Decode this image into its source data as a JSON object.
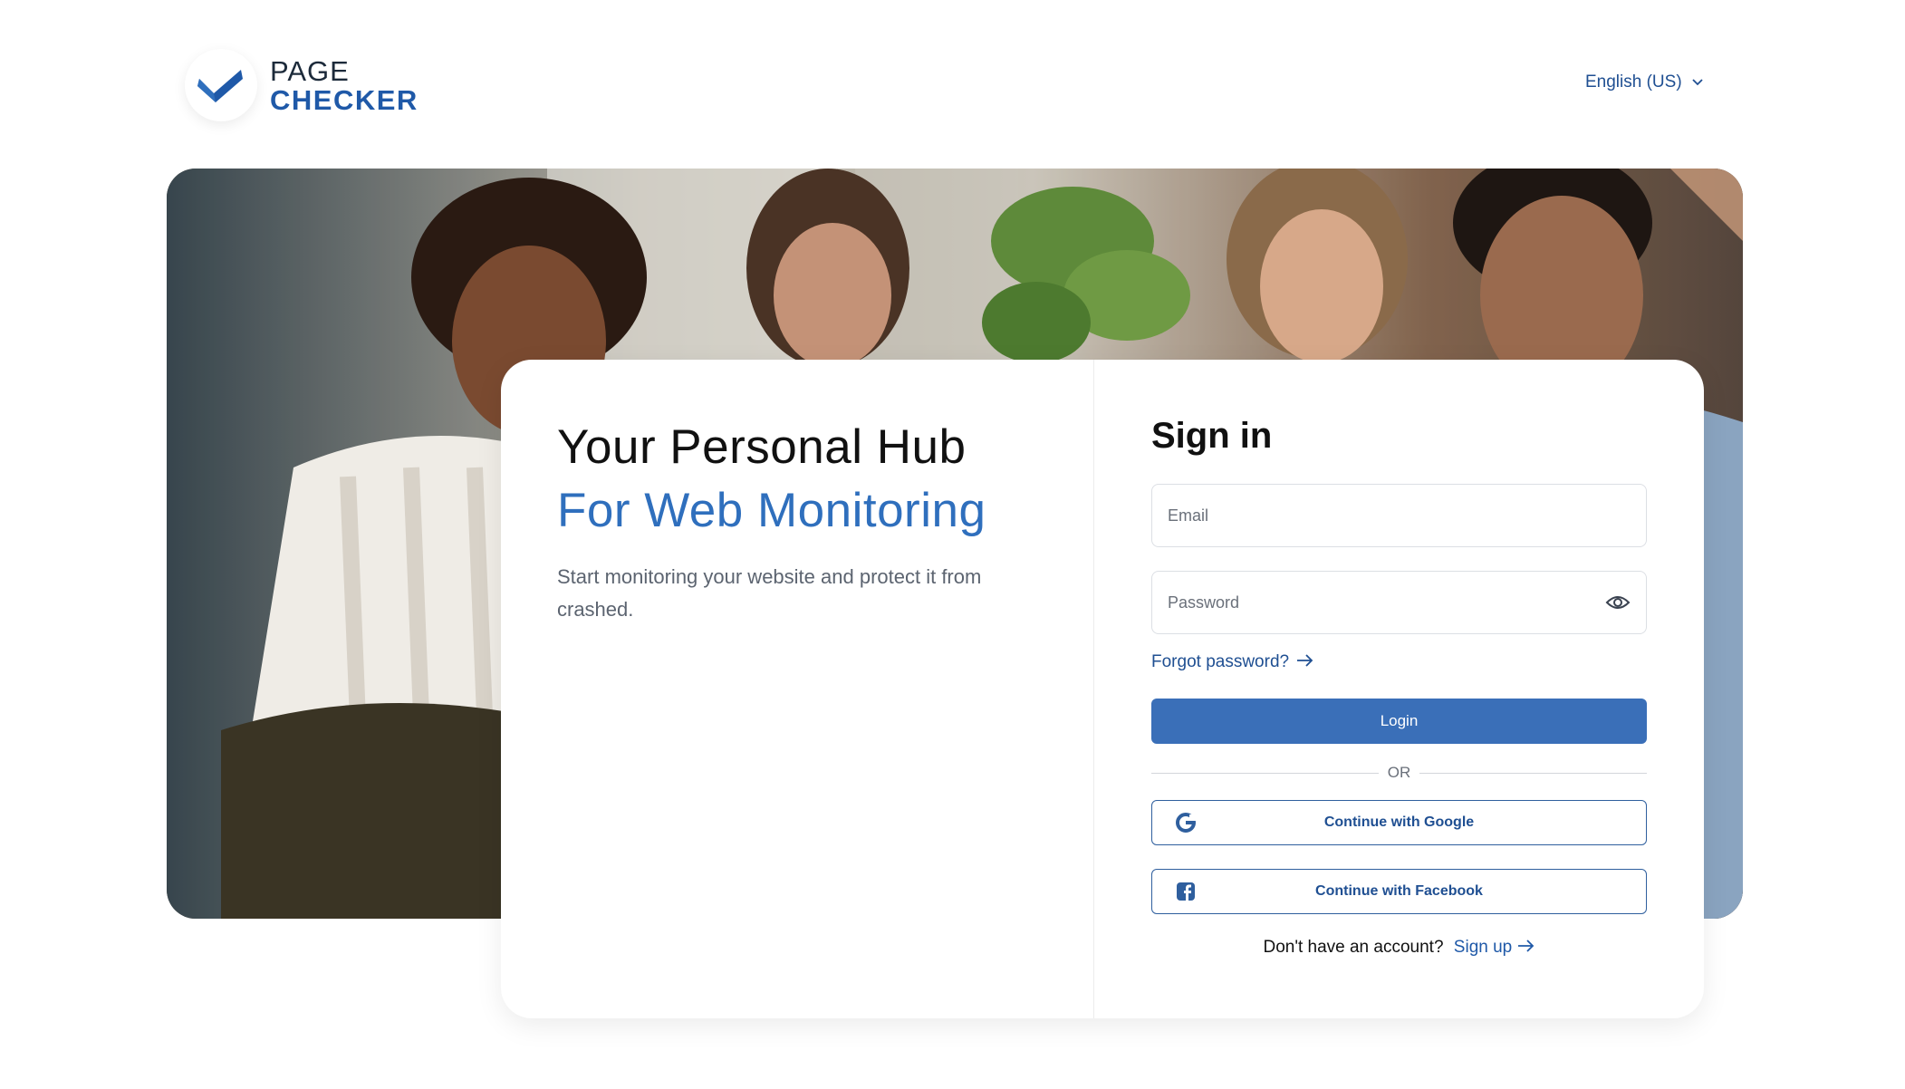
{
  "header": {
    "logo_line1": "PAGE",
    "logo_line2": "CHECKER",
    "language": "English (US)"
  },
  "hero": {
    "title_line1": "Your Personal Hub",
    "title_line2": "For Web Monitoring",
    "subtitle": "Start monitoring your website and protect it from crashed."
  },
  "signin": {
    "title": "Sign in",
    "email_placeholder": "Email",
    "password_placeholder": "Password",
    "forgot_label": "Forgot password?",
    "login_label": "Login",
    "or_label": "OR",
    "google_label": "Continue with Google",
    "facebook_label": "Continue with Facebook",
    "no_account_text": "Don't have an account?",
    "signup_label": "Sign up"
  },
  "colors": {
    "brand_blue": "#1f59a8",
    "accent_blue": "#2f6fbd",
    "button_blue": "#3a6fb8"
  }
}
